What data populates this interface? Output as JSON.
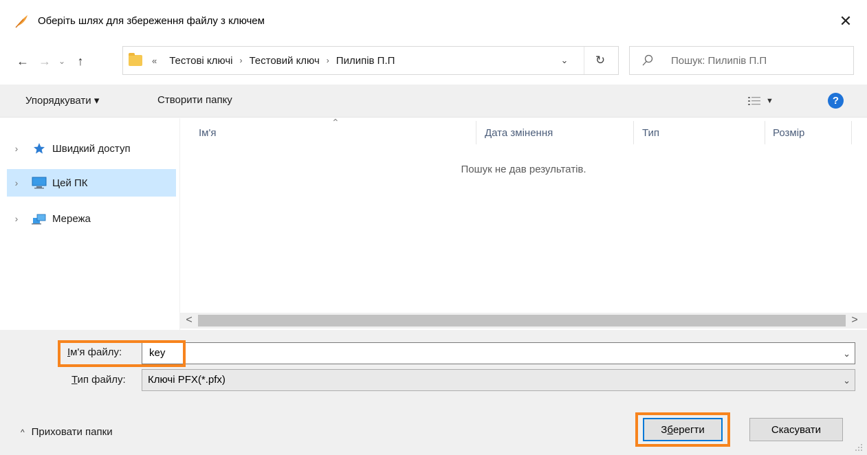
{
  "window": {
    "title": "Оберіть шлях для збереження файлу з ключем",
    "close_glyph": "✕",
    "icon": "feather-icon"
  },
  "nav": {
    "back_glyph": "←",
    "forward_glyph": "→",
    "recent_glyph": "⌄",
    "up_glyph": "↑"
  },
  "address": {
    "overflow": "«",
    "breadcrumbs": [
      "Тестові ключі",
      "Тестовий ключ",
      "Пилипів П.П"
    ],
    "separator": "›",
    "dropdown_glyph": "⌄",
    "refresh_glyph": "↻"
  },
  "search": {
    "placeholder": "Пошук: Пилипів П.П"
  },
  "toolbar": {
    "organize_label": "Упорядкувати ▾",
    "new_folder_label": "Створити папку",
    "help_glyph": "?"
  },
  "sidebar": {
    "items": [
      {
        "label": "Швидкий доступ",
        "icon": "star-icon",
        "selected": false
      },
      {
        "label": "Цей ПК",
        "icon": "computer-icon",
        "selected": true
      },
      {
        "label": "Мережа",
        "icon": "network-icon",
        "selected": false
      }
    ]
  },
  "filelist": {
    "columns": [
      "Ім'я",
      "Дата змінення",
      "Тип",
      "Розмір"
    ],
    "empty_message": "Пошук не дав результатів."
  },
  "scrollbar": {
    "left_glyph": "<",
    "right_glyph": ">"
  },
  "form": {
    "filename_label_underlined": "І",
    "filename_label_rest": "м'я файлу:",
    "filename_value": "key",
    "filetype_label_underlined": "Т",
    "filetype_label_rest": "ип файлу:",
    "filetype_value": "Ключі PFX(*.pfx)"
  },
  "footer": {
    "hide_folders_label": "Приховати папки",
    "save_label_pre": "З",
    "save_label_underlined": "б",
    "save_label_post": "ерегти",
    "cancel_label": "Скасувати"
  },
  "colors": {
    "highlight": "#f7841e",
    "selection": "#cce8ff",
    "accent": "#0078d7"
  }
}
